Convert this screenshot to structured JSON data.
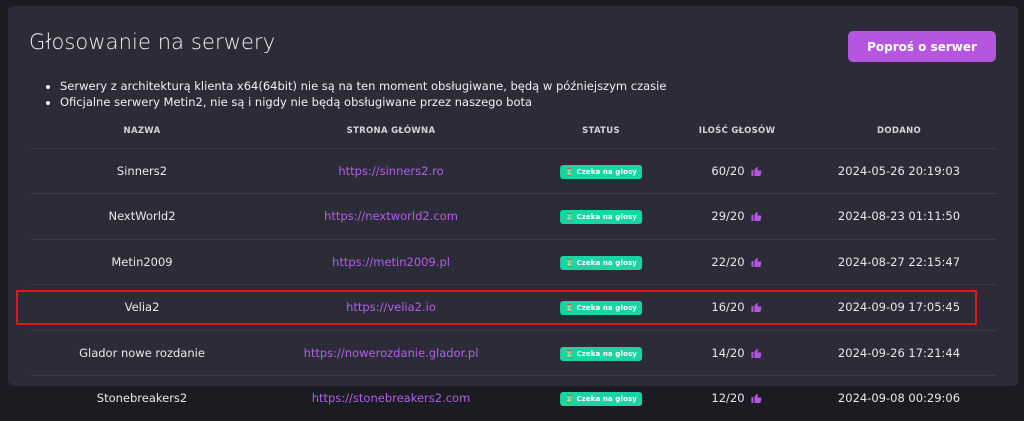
{
  "page": {
    "title": "Głosowanie na serwery",
    "request_button": "Poproś o serwer",
    "notes": [
      "Serwery z architekturą klienta x64(64bit) nie są na ten moment obsługiwane, będą w późniejszym czasie",
      "Oficjalne serwery Metin2, nie są i nigdy nie będą obsługiwane przez naszego bota"
    ]
  },
  "table": {
    "headers": {
      "name": "NAZWA",
      "homepage": "STRONA GŁÓWNA",
      "status": "STATUS",
      "votes": "ILOŚĆ GŁOSÓW",
      "added": "DODANO"
    },
    "rows": [
      {
        "name": "Sinners2",
        "url": "https://sinners2.ro",
        "status": "Czeka na głosy",
        "votes": "60/20",
        "added": "2024-05-26 20:19:03"
      },
      {
        "name": "NextWorld2",
        "url": "https://nextworld2.com",
        "status": "Czeka na głosy",
        "votes": "29/20",
        "added": "2024-08-23 01:11:50"
      },
      {
        "name": "Metin2009",
        "url": "https://metin2009.pl",
        "status": "Czeka na głosy",
        "votes": "22/20",
        "added": "2024-08-27 22:15:47"
      },
      {
        "name": "Velia2",
        "url": "https://velia2.io",
        "status": "Czeka na głosy",
        "votes": "16/20",
        "added": "2024-09-09 17:05:45"
      },
      {
        "name": "Glador nowe rozdanie",
        "url": "https://nowerozdanie.glador.pl",
        "status": "Czeka na głosy",
        "votes": "14/20",
        "added": "2024-09-26 17:21:44"
      },
      {
        "name": "Stonebreakers2",
        "url": "https://stonebreakers2.com",
        "status": "Czeka na głosy",
        "votes": "12/20",
        "added": "2024-09-08 00:29:06"
      }
    ]
  },
  "colors": {
    "accent": "#b456e0",
    "link": "#b35ee8",
    "status_badge": "#18d6a4",
    "highlight_border": "#e01818"
  },
  "icons": {
    "vote": "thumbs-up-icon",
    "status": "hourglass-icon"
  }
}
